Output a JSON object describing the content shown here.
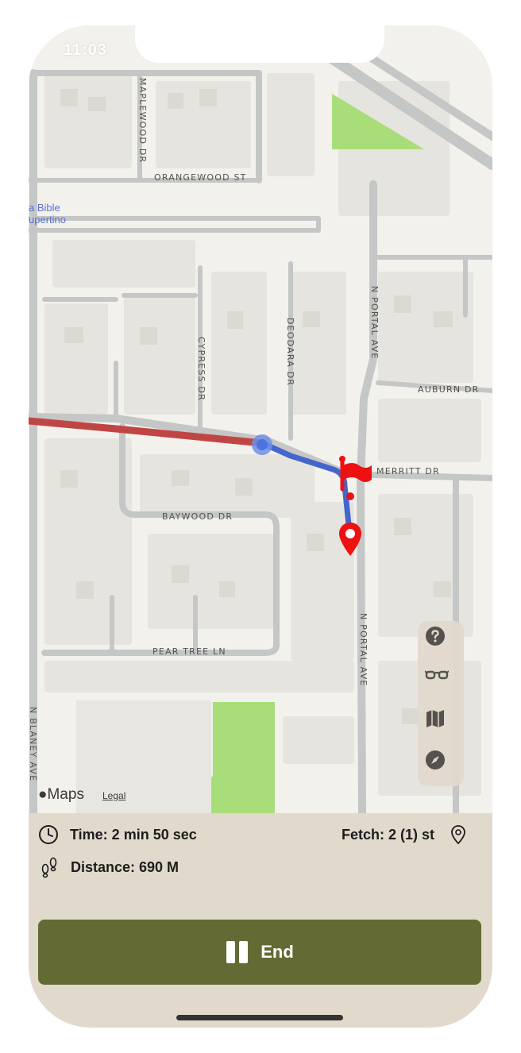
{
  "status_bar": {
    "time": "11:03"
  },
  "map": {
    "poi_label_line1": "a Bible",
    "poi_label_line2": "upertino",
    "streets": {
      "maplewood": "MAPLEWOOD DR",
      "orangewood": "ORANGEWOOD ST",
      "cypress": "CYPRESS DR",
      "deodara": "DEODARA DR",
      "portal_north": "N PORTAL AVE",
      "auburn": "AUBURN DR",
      "merritt": "MERRITT DR",
      "baywood": "BAYWOOD DR",
      "portal_south": "N PORTAL AVE",
      "pear_tree": "PEAR TREE LN",
      "blaney": "N BLANEY AVE"
    },
    "attribution": {
      "logo_text": "Maps",
      "legal": "Legal"
    },
    "colors": {
      "route_past": "#c04545",
      "route_current": "#4466cc",
      "marker": "#ee1111",
      "park": "#a8dd7a"
    }
  },
  "toolbar": {
    "items": [
      {
        "icon": "question-icon"
      },
      {
        "icon": "glasses-icon"
      },
      {
        "icon": "map-icon"
      },
      {
        "icon": "compass-icon"
      }
    ]
  },
  "stats": {
    "time_label": "Time: 2 min 50 sec",
    "fetch_label": "Fetch: 2 (1) st",
    "distance_label": "Distance: 690 M"
  },
  "end_button": {
    "label": "End",
    "color": "#646a33"
  }
}
